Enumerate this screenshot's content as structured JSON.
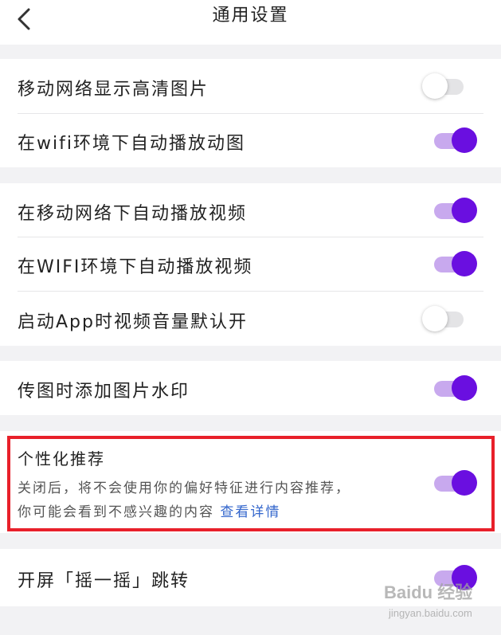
{
  "header": {
    "title": "通用设置"
  },
  "group1": {
    "rows": [
      {
        "label": "移动网络显示高清图片",
        "toggle": "off"
      },
      {
        "label": "在wifi环境下自动播放动图",
        "toggle": "on"
      }
    ]
  },
  "group2": {
    "rows": [
      {
        "label": "在移动网络下自动播放视频",
        "toggle": "on"
      },
      {
        "label": "在WIFI环境下自动播放视频",
        "toggle": "on"
      },
      {
        "label": "启动App时视频音量默认开",
        "toggle": "off"
      }
    ]
  },
  "group3": {
    "rows": [
      {
        "label": "传图时添加图片水印",
        "toggle": "on"
      }
    ]
  },
  "recommend": {
    "title": "个性化推荐",
    "desc_line1": "关闭后，将不会使用你的偏好特征进行内容推荐，",
    "desc_line2": "你可能会看到不感兴趣的内容",
    "link": "查看详情",
    "toggle": "on"
  },
  "group5": {
    "rows": [
      {
        "label": "开屏「摇一摇」跳转",
        "toggle": "on"
      }
    ]
  },
  "watermark": {
    "brand": "Baidu 经验",
    "sub": "jingyan.baidu.com"
  },
  "colors": {
    "accent": "#6a0fe0",
    "accent_track": "#c8a9ee",
    "highlight": "#e8202a",
    "link": "#3366cc"
  }
}
